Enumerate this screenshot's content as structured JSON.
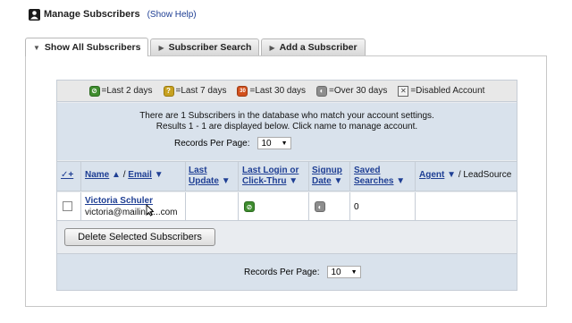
{
  "header": {
    "title": "Manage Subscribers",
    "help_link": "(Show Help)"
  },
  "tabs": [
    {
      "label": "Show All Subscribers",
      "active": true
    },
    {
      "label": "Subscriber Search",
      "active": false
    },
    {
      "label": "Add a Subscriber",
      "active": false
    }
  ],
  "legend": [
    {
      "icon": "green-status-icon",
      "text": "=Last 2 days",
      "color": "#3e8c2e"
    },
    {
      "icon": "yellow-status-icon",
      "text": "=Last 7 days",
      "color": "#c7a120"
    },
    {
      "icon": "orange-status-icon",
      "text": "=Last 30 days",
      "color": "#d2501c"
    },
    {
      "icon": "gray-status-icon",
      "text": "=Over 30 days",
      "color": "#8d8d8d"
    },
    {
      "icon": "disabled-box-icon",
      "text": "=Disabled Account"
    }
  ],
  "info": {
    "line1": "There are 1 Subscribers in the database who match your account settings.",
    "line2": "Results 1 - 1 are displayed below. Click name to manage account.",
    "records_label": "Records Per Page:",
    "records_value": "10"
  },
  "table": {
    "headers": {
      "check": "✓+",
      "name": "Name",
      "email": "Email",
      "last_update_1": "Last",
      "last_update_2": "Update",
      "last_login_1": "Last Login or",
      "last_login_2": "Click-Thru",
      "signup_1": "Signup",
      "signup_2": "Date",
      "saved_1": "Saved",
      "saved_2": "Searches",
      "agent": "Agent",
      "leadsource": "/ LeadSource"
    },
    "rows": [
      {
        "name": "Victoria Schuler",
        "email": "victoria@mailinat...com",
        "last_update": "",
        "last_login_icon": "green-status-icon",
        "signup_icon": "gray-status-icon",
        "saved_searches": "0",
        "agent": ""
      }
    ]
  },
  "actions": {
    "delete_label": "Delete Selected Subscribers"
  },
  "footer": {
    "records_label": "Records Per Page:",
    "records_value": "10"
  },
  "colors": {
    "link": "#1f3f94",
    "panel_blue": "#d9e2ec"
  }
}
